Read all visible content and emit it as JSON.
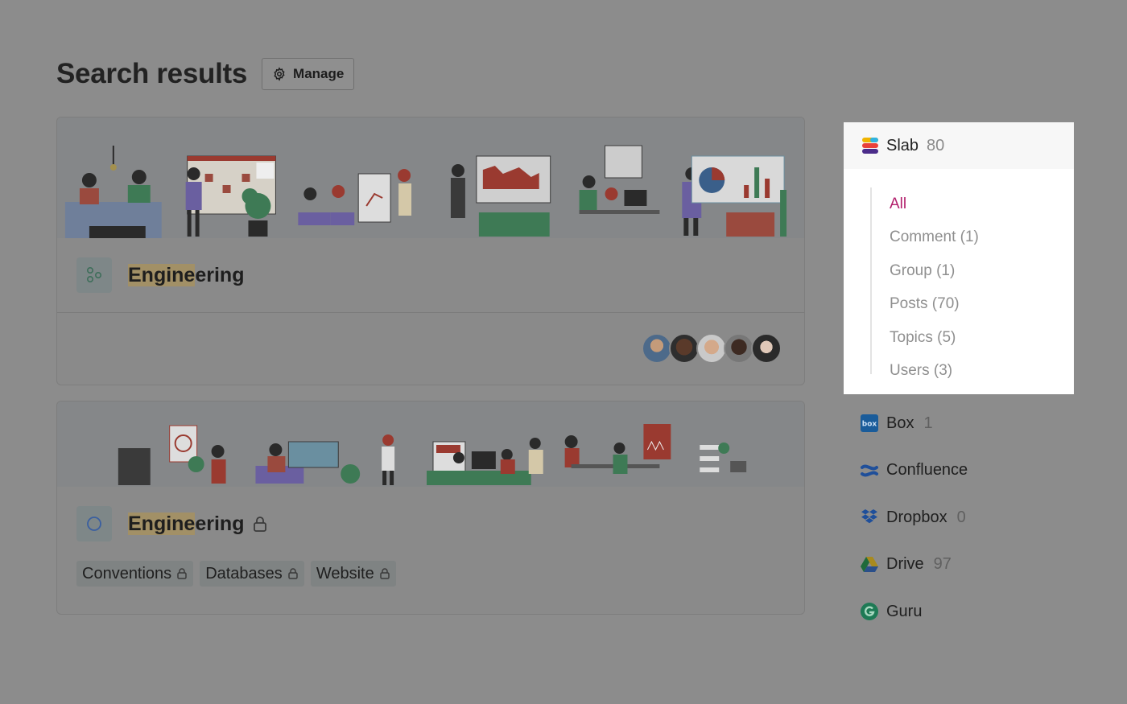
{
  "header": {
    "title": "Search results",
    "manage_label": "Manage"
  },
  "results": [
    {
      "title_highlight": "Engine",
      "title_rest": "ering",
      "icon": "group-icon",
      "locked": false
    },
    {
      "title_highlight": "Engine",
      "title_rest": "ering",
      "icon": "circle-icon",
      "locked": true,
      "tags": [
        "Conventions",
        "Databases",
        "Website"
      ]
    }
  ],
  "filter_panel": {
    "source": {
      "name": "Slab",
      "count": "80",
      "icon": "slab-logo-icon"
    },
    "filters": [
      "All",
      "Comment (1)",
      "Group (1)",
      "Posts (70)",
      "Topics (5)",
      "Users (3)"
    ],
    "active_filter": "All"
  },
  "sources": [
    {
      "name": "Box",
      "count": "1",
      "icon": "box-logo-icon"
    },
    {
      "name": "Confluence",
      "count": "",
      "icon": "confluence-logo-icon"
    },
    {
      "name": "Dropbox",
      "count": "0",
      "icon": "dropbox-logo-icon"
    },
    {
      "name": "Drive",
      "count": "97",
      "icon": "drive-logo-icon"
    },
    {
      "name": "Guru",
      "count": "",
      "icon": "guru-logo-icon"
    }
  ],
  "colors": {
    "accent": "#b21f6c",
    "overlay": "#8c8c8c",
    "highlight": "#a29066"
  }
}
